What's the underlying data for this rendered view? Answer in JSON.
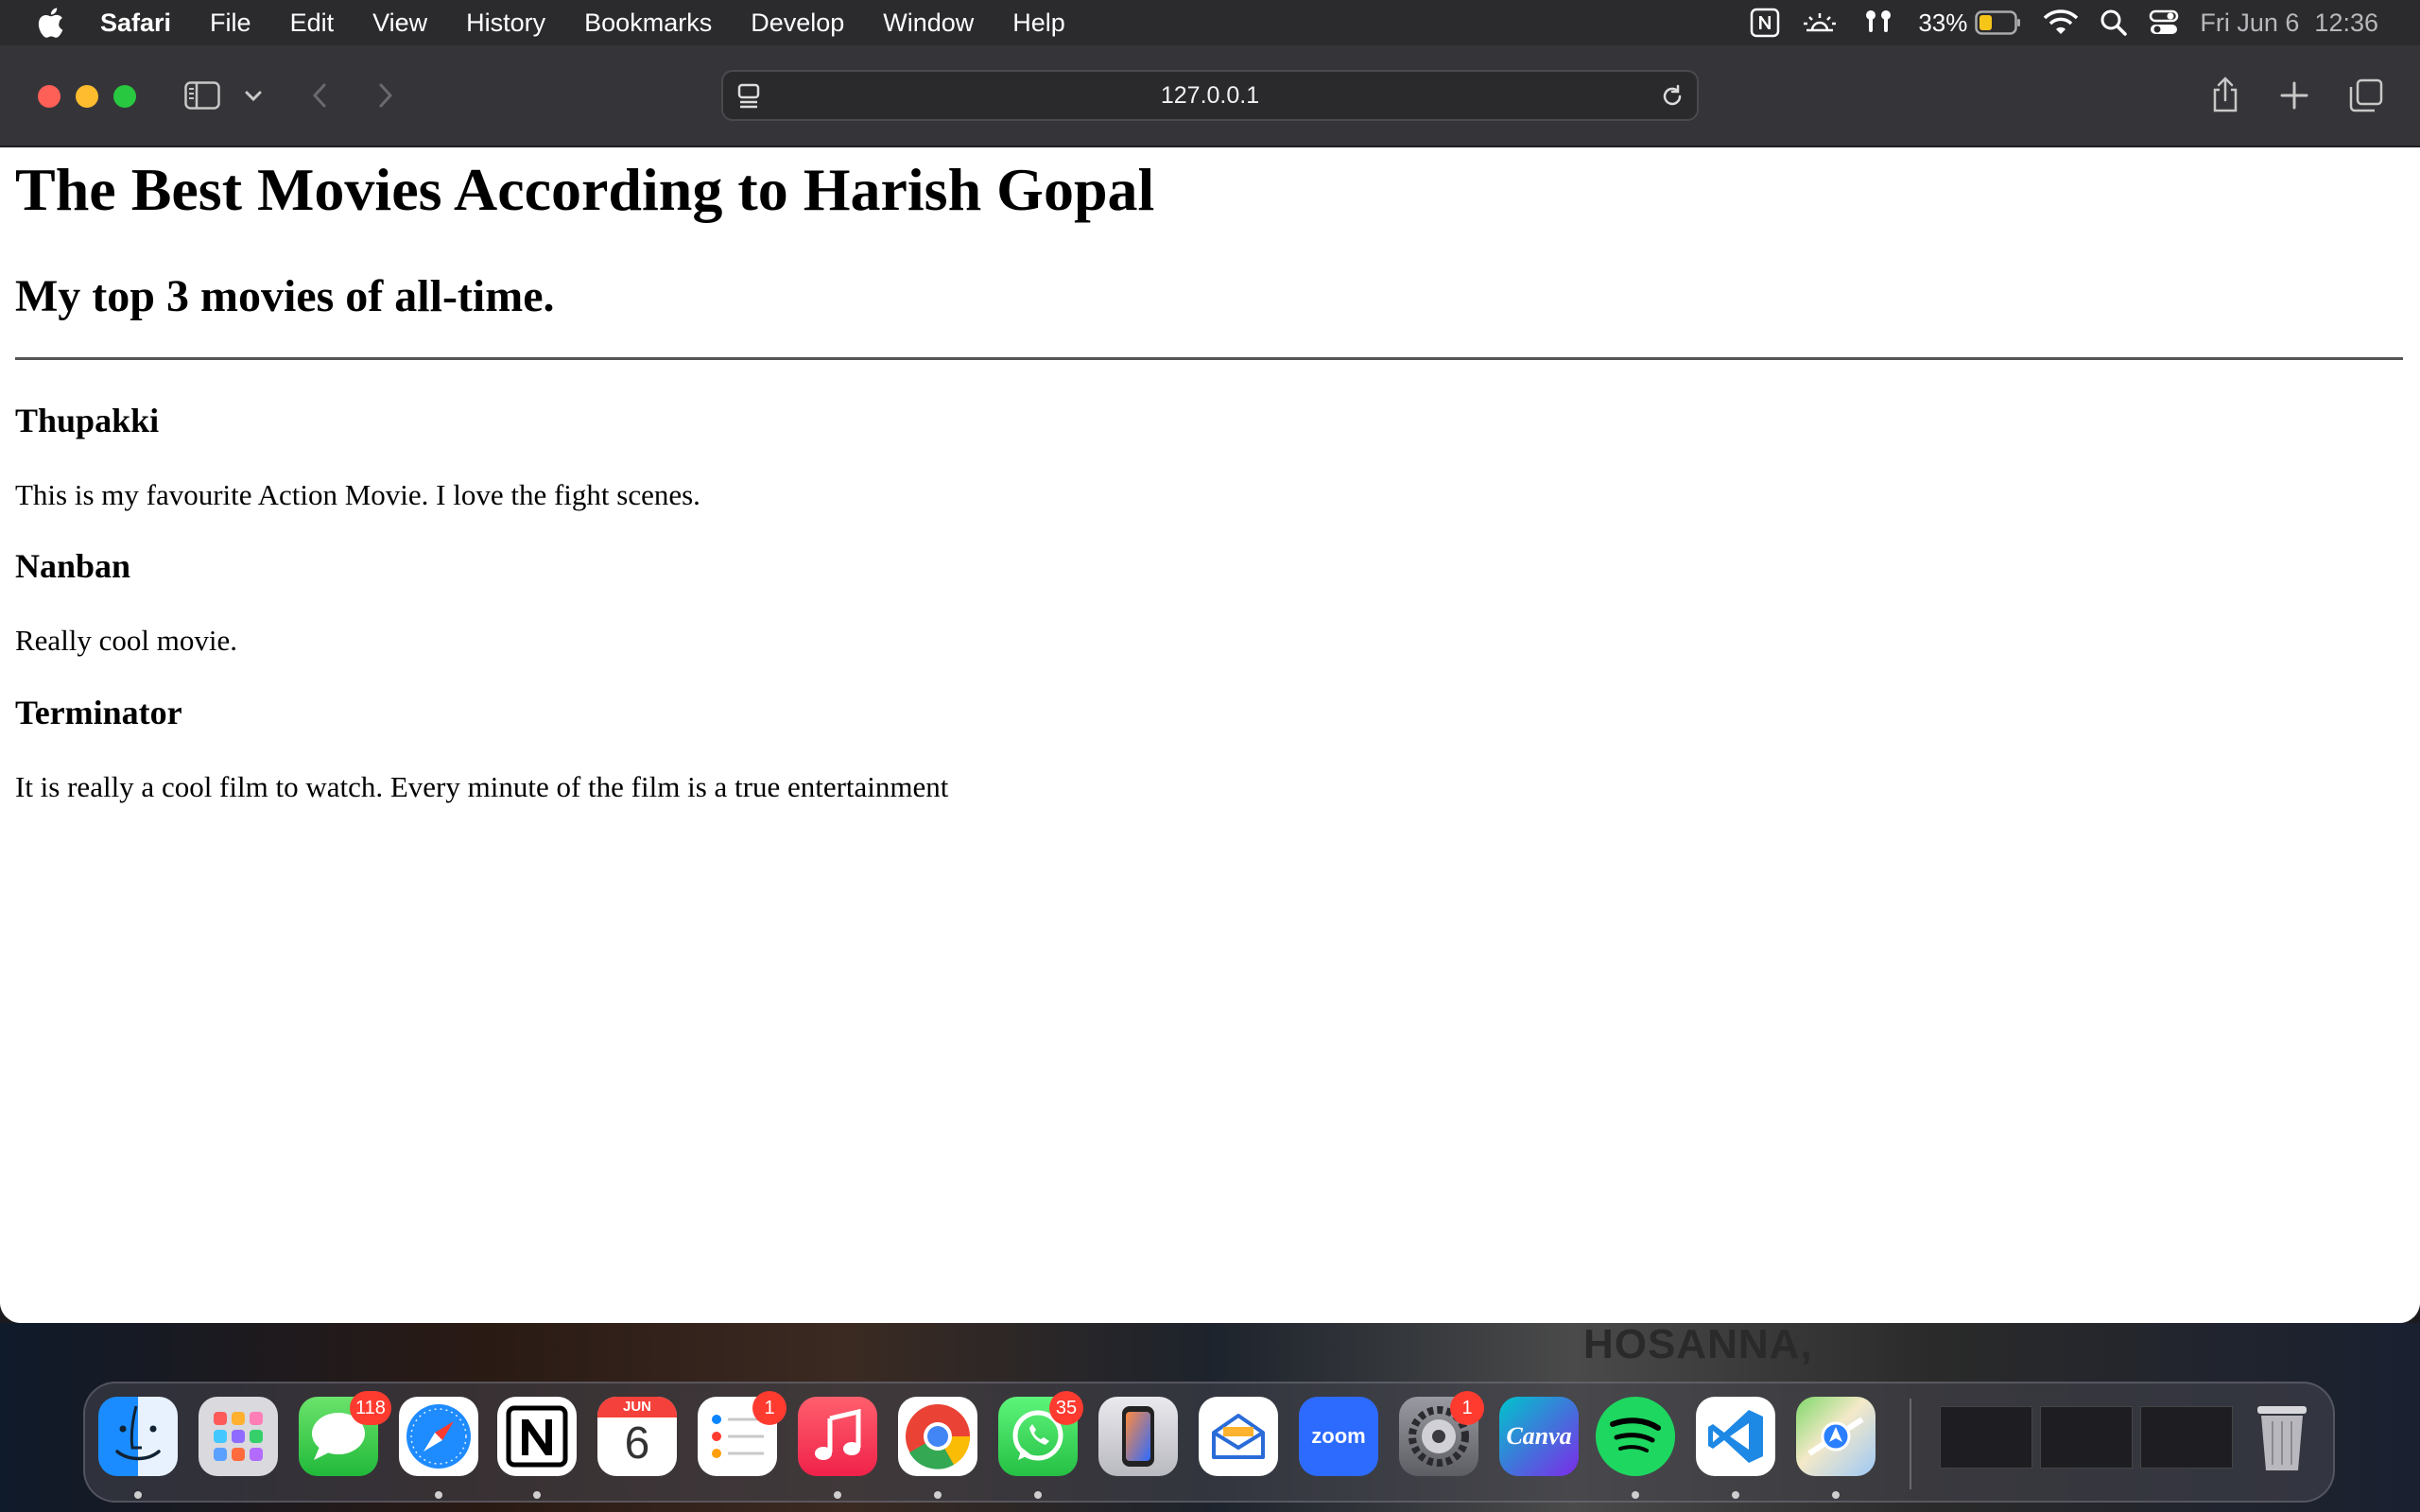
{
  "menubar": {
    "app_name": "Safari",
    "items": [
      "File",
      "Edit",
      "View",
      "History",
      "Bookmarks",
      "Develop",
      "Window",
      "Help"
    ],
    "battery_percent": "33%",
    "date": "Fri Jun 6",
    "time": "12:36"
  },
  "browser": {
    "url": "127.0.0.1"
  },
  "page": {
    "title": "The Best Movies According to Harish Gopal",
    "subtitle": "My top 3 movies of all-time.",
    "movies": [
      {
        "title": "Thupakki",
        "description": "This is my favourite Action Movie. I love the fight scenes."
      },
      {
        "title": "Nanban",
        "description": "Really cool movie."
      },
      {
        "title": "Terminator",
        "description": "It is really a cool film to watch. Every minute of the film is a true entertainment"
      }
    ]
  },
  "desktop": {
    "wallpaper_text": "HOSANNA,"
  },
  "dock": {
    "calendar_month": "JUN",
    "calendar_day": "6",
    "zoom_label": "zoom",
    "canva_label": "Canva",
    "badges": {
      "messages": "118",
      "reminders": "1",
      "whatsapp": "35",
      "system_settings": "1"
    }
  }
}
